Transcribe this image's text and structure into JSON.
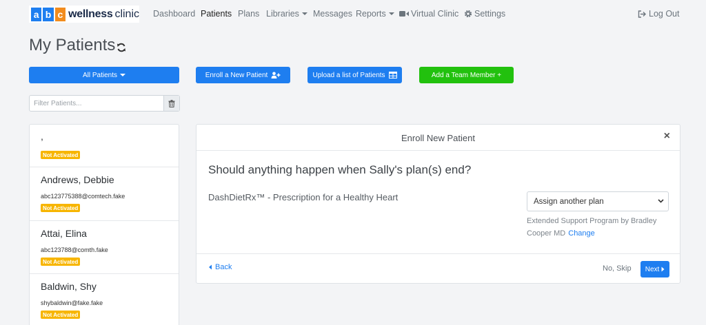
{
  "logo": {
    "letters": [
      "a",
      "b",
      "c"
    ],
    "letter_colors": [
      "#1e7ef0",
      "#1e7ef0",
      "#f28c1e"
    ],
    "word1": "wellness",
    "word2": "clinic"
  },
  "nav": {
    "items": [
      {
        "label": "Dashboard"
      },
      {
        "label": "Patients"
      },
      {
        "label": "Plans"
      },
      {
        "label": "Libraries"
      },
      {
        "label": "Messages"
      },
      {
        "label": "Reports"
      },
      {
        "label": "Virtual Clinic",
        "icon": "video-icon"
      },
      {
        "label": "Settings",
        "icon": "gear-icon"
      }
    ],
    "active": "Patients",
    "logout": "Log Out"
  },
  "page": {
    "title": "My Patients"
  },
  "toolbar": {
    "all_patients": "All Patients",
    "enroll": "Enroll a New Patient",
    "upload": "Upload a list of Patients",
    "add_team": "Add a Team Member +"
  },
  "filter": {
    "placeholder": "Filter Patients..."
  },
  "patients": [
    {
      "name": ",",
      "email": "",
      "status": "Not Activated"
    },
    {
      "name": "Andrews, Debbie",
      "email": "abc123775388@comtech.fake",
      "status": "Not Activated"
    },
    {
      "name": "Attai, Elina",
      "email": "abc123788@comth.fake",
      "status": "Not Activated"
    },
    {
      "name": "Baldwin, Shy",
      "email": "shybaldwin@fake.fake",
      "status": "Not Activated"
    }
  ],
  "modal": {
    "title": "Enroll New Patient",
    "close": "×",
    "question": "Should anything happen when Sally's plan(s) end?",
    "plan_name": "DashDietRx™ - Prescription for a Healthy Heart",
    "select_value": "Assign another plan",
    "extended": "Extended Support Program by Bradley Cooper MD",
    "change": "Change",
    "back": "Back",
    "skip": "No, Skip",
    "next": "Next"
  },
  "colors": {
    "primary": "#1e7ef0",
    "success": "#22c10e",
    "warning": "#f7b500",
    "background": "#f3f4f6"
  }
}
